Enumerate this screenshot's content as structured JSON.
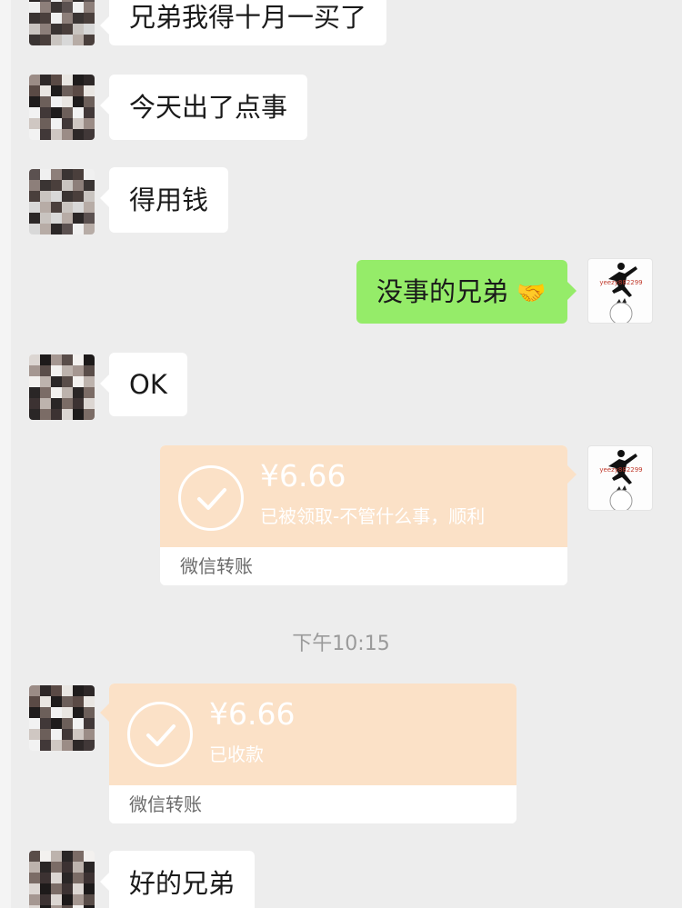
{
  "messages": [
    {
      "text": "兄弟我得十月一买了"
    },
    {
      "text": "今天出了点事"
    },
    {
      "text": "得用钱"
    },
    {
      "text": "没事的兄弟",
      "emoji": "🤝"
    },
    {
      "text": "OK"
    },
    {
      "text": "好的兄弟"
    }
  ],
  "self_avatar": {
    "caption": "yeezy882299"
  },
  "transfer_sent": {
    "amount": "¥6.66",
    "note": "已被领取-不管什么事，顺利",
    "label": "微信转账"
  },
  "timestamp": "下午10:15",
  "transfer_received": {
    "amount": "¥6.66",
    "note": "已收款",
    "label": "微信转账"
  },
  "colors": {
    "background": "#ededed",
    "bubble_incoming": "#ffffff",
    "bubble_outgoing": "#95ec69",
    "transfer_card": "#fbe1c7"
  }
}
